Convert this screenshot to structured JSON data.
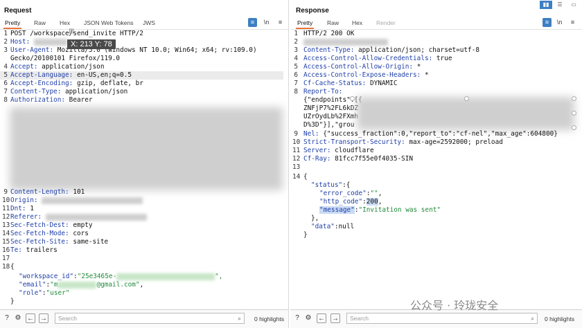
{
  "request": {
    "title": "Request",
    "tabs": [
      "Pretty",
      "Raw",
      "Hex",
      "JSON Web Tokens",
      "JWS"
    ],
    "tool_icons": {
      "wrap": "≡",
      "newline": "\\n",
      "menu": "≡"
    },
    "lines": {
      "1": {
        "n": "1",
        "text": "POST /workspace/send_invite HTTP/2"
      },
      "2": {
        "n": "2",
        "key": "Host:"
      },
      "3": {
        "n": "3",
        "key": "User-Agent:",
        "value": " Mozilla/5.0 (Windows NT 10.0; Win64; x64; rv:109.0)"
      },
      "3b": {
        "text": "Gecko/20100101 Firefox/119.0"
      },
      "4": {
        "n": "4",
        "key": "Accept:",
        "value": " application/json"
      },
      "5": {
        "n": "5",
        "key": "Accept-Language:",
        "value": " en-US,en;q=0.5"
      },
      "6": {
        "n": "6",
        "key": "Accept-Encoding:",
        "value": " gzip, deflate, br"
      },
      "7": {
        "n": "7",
        "key": "Content-Type:",
        "value": " application/json"
      },
      "8": {
        "n": "8",
        "key": "Authorization:",
        "value": " Bearer"
      },
      "9": {
        "n": "9",
        "key": "Content-Length:",
        "value": " 101"
      },
      "10": {
        "n": "10",
        "key": "Origin:"
      },
      "11": {
        "n": "11",
        "key": "Dnt:",
        "value": " 1"
      },
      "12": {
        "n": "12",
        "key": "Referer:"
      },
      "13": {
        "n": "13",
        "key": "Sec-Fetch-Dest:",
        "value": " empty"
      },
      "14": {
        "n": "14",
        "key": "Sec-Fetch-Mode:",
        "value": " cors"
      },
      "15": {
        "n": "15",
        "key": "Sec-Fetch-Site:",
        "value": " same-site"
      },
      "16": {
        "n": "16",
        "key": "Te:",
        "value": " trailers"
      },
      "17": {
        "n": "17"
      },
      "18": {
        "n": "18",
        "text": "{"
      },
      "19": {
        "n": "",
        "key": "\"workspace_id\"",
        "value": "\"25e3465e-"
      },
      "19end": {
        "text": "\","
      },
      "20": {
        "key": "\"email\"",
        "value": "\"m",
        "value2": "@gmail.com\""
      },
      "20end": {
        "text": ","
      },
      "21": {
        "key": "\"role\"",
        "value": "\"user\""
      },
      "22": {
        "text": "}"
      }
    },
    "tooltip": "X: 213 Y: 78",
    "footer": {
      "search_placeholder": "Search",
      "highlights": "0 highlights"
    }
  },
  "response": {
    "title": "Response",
    "tabs": [
      "Pretty",
      "Raw",
      "Hex",
      "Render"
    ],
    "tool_icons": {
      "wrap": "≡",
      "newline": "\\n",
      "menu": "≡"
    },
    "lines": {
      "1": {
        "n": "1",
        "text": "HTTP/2 200 OK"
      },
      "2": {
        "n": "2"
      },
      "3": {
        "n": "3",
        "key": "Content-Type:",
        "value": " application/json; charset=utf-8"
      },
      "4": {
        "n": "4",
        "key": "Access-Control-Allow-Credentials:",
        "value": " true"
      },
      "5": {
        "n": "5",
        "key": "Access-Control-Allow-Origin:",
        "value": " *"
      },
      "6": {
        "n": "6",
        "key": "Access-Control-Expose-Headers:",
        "value": " *"
      },
      "7": {
        "n": "7",
        "key": "Cf-Cache-Status:",
        "value": " DYNAMIC"
      },
      "8": {
        "n": "8",
        "key": "Report-To:"
      },
      "8a": {
        "text": "{\"endpoints\":[{"
      },
      "8b": {
        "text": "ZNFjP7%2FL6kDZ"
      },
      "8c": {
        "text": "UZrOydLb%2FXmh"
      },
      "8d": {
        "text": "D%3D\"}],\"grou"
      },
      "9": {
        "n": "9",
        "key": "Nel:",
        "value": " {\"success_fraction\":0,\"report_to\":\"cf-nel\",\"max_age\":604800}"
      },
      "10": {
        "n": "10",
        "key": "Strict-Transport-Security:",
        "value": " max-age=2592000; preload"
      },
      "11": {
        "n": "11",
        "key": "Server:",
        "value": " cloudflare"
      },
      "12": {
        "n": "12",
        "key": "Cf-Ray:",
        "value": " 81fcc7f55e0f4035-SIN"
      },
      "13": {
        "n": "13"
      },
      "14": {
        "n": "14",
        "text": "{"
      },
      "15": {
        "key": "\"status\"",
        "value": ":{"
      },
      "16": {
        "key": "\"error_code\"",
        "value": "\"\""
      },
      "17": {
        "key": "\"http_code\"",
        "value": "200"
      },
      "18": {
        "key": "\"message\"",
        "value": "\"Invitation was sent\""
      },
      "19": {
        "text": "},"
      },
      "20": {
        "key": "\"data\"",
        "value": "null"
      },
      "21": {
        "text": "}"
      }
    },
    "footer": {
      "search_placeholder": "Search",
      "highlights": "0 highlights"
    }
  },
  "layout_buttons": [
    "▮▮",
    "☰",
    "▭"
  ],
  "watermark": "公众号 · 玲珑安全"
}
